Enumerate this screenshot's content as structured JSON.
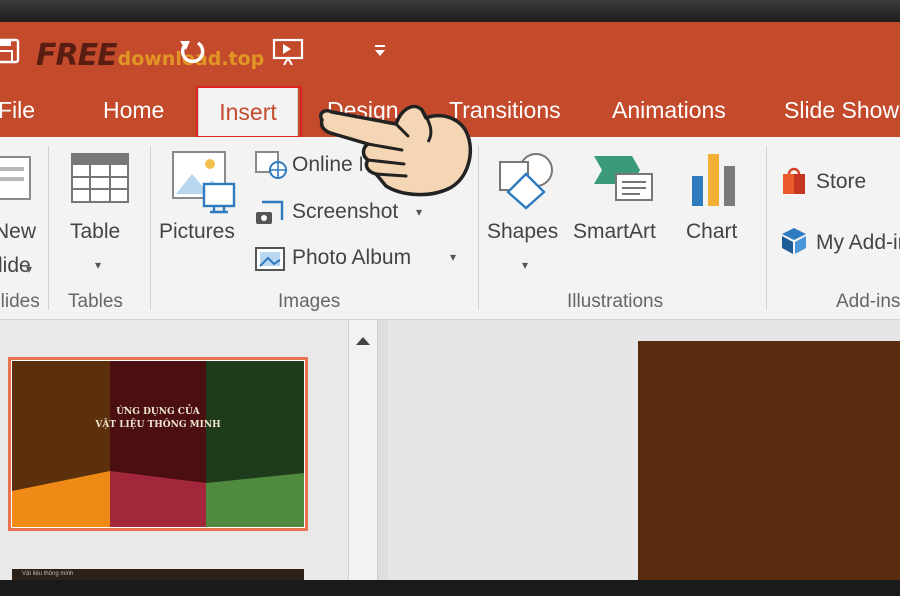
{
  "watermark": {
    "brand": "FREE",
    "domain": "download",
    "tld": ".top"
  },
  "tabs": [
    {
      "label": "File"
    },
    {
      "label": "Home"
    },
    {
      "label": "Insert",
      "active": true
    },
    {
      "label": "Design"
    },
    {
      "label": "Transitions"
    },
    {
      "label": "Animations"
    },
    {
      "label": "Slide Show"
    }
  ],
  "ribbon": {
    "slides": {
      "new_slide_line1": "New",
      "new_slide_line2": "Slide",
      "group": "Slides"
    },
    "tables": {
      "table": "Table",
      "group": "Tables"
    },
    "images": {
      "pictures": "Pictures",
      "online": "Online Pictures",
      "screenshot": "Screenshot",
      "photo_album": "Photo Album",
      "group": "Images"
    },
    "illustrations": {
      "shapes": "Shapes",
      "smartart": "SmartArt",
      "chart": "Chart",
      "group": "Illustrations"
    },
    "addins": {
      "store": "Store",
      "my_addins": "My Add-ins",
      "group": "Add-ins"
    }
  },
  "slides": [
    {
      "title_line1": "ỨNG DỤNG CỦA",
      "title_line2": "VẬT LIỆU THÔNG MINH",
      "selected": true
    },
    {
      "title_line1": "Vật liệu thông minh"
    }
  ],
  "colors": {
    "accent": "#c44a2c",
    "selection": "#e8734f",
    "slide_bg": "#5a2b0e"
  },
  "icons": [
    "save-icon",
    "undo-icon",
    "start-from-beginning-icon",
    "customize-qat-icon",
    "table-icon",
    "pictures-icon",
    "online-pictures-icon",
    "screenshot-icon",
    "photo-album-icon",
    "shapes-icon",
    "smartart-icon",
    "chart-icon",
    "store-icon",
    "my-addins-icon",
    "hand-cursor-icon",
    "scroll-up-icon"
  ]
}
